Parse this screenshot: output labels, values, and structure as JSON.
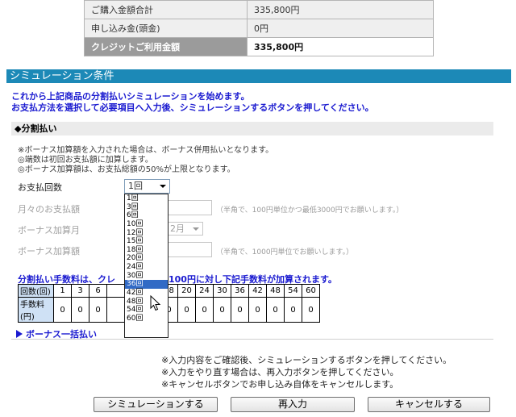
{
  "summary": {
    "rows": [
      {
        "label": "ご購入金額合計",
        "value": "335,800円"
      },
      {
        "label": "申し込み金(頭金)",
        "value": "0円"
      },
      {
        "label": "クレジットご利用金額",
        "value": "335,800円"
      }
    ]
  },
  "section": {
    "title": "シミュレーション条件",
    "intro1": "これから上記商品の分割払いシミュレーションを始めます。",
    "intro2": "お支払方法を選択して必要項目へ入力後、シミュレーションするボタンを押してください。"
  },
  "installment": {
    "heading": "◆分割払い",
    "notes": [
      "※ボーナス加算額を入力された場合は、ボーナス併用払いとなります。",
      "◎端数は初回お支払額に加算します。",
      "◎ボーナス加算額は、お支払総額の50%が上限となります。"
    ],
    "count_label": "お支払回数",
    "count_value": "1回",
    "monthly_label": "月々のお支払額",
    "monthly_hint": "（半角で、100円単位かつ最低3000円でお願いします。）",
    "bonus_month_label": "ボーナス加算月",
    "bonus_month_value": "2月",
    "bonus_amount_label": "ボーナス加算額",
    "bonus_amount_hint": "（半角で、1000円単位でお願いします。）"
  },
  "dropdown": {
    "options": [
      "1回",
      "3回",
      "6回",
      "10回",
      "12回",
      "15回",
      "18回",
      "20回",
      "24回",
      "30回",
      "36回",
      "42回",
      "48回",
      "54回",
      "60回"
    ],
    "highlighted": "36回"
  },
  "fee": {
    "heading": "分割払い手数料は、クレ　　　　金額100円に対し下記手数料が加算されます。",
    "row1_header": "回数(回)",
    "row2_header": "手数料(円)",
    "counts": [
      "1",
      "3",
      "6",
      "",
      "",
      "15",
      "18",
      "20",
      "24",
      "30",
      "36",
      "42",
      "48",
      "54",
      "60"
    ],
    "fees": [
      "0",
      "0",
      "0",
      "",
      "",
      "0",
      "0",
      "0",
      "0",
      "0",
      "0",
      "0",
      "0",
      "0",
      "0"
    ]
  },
  "bonus_lump": {
    "label": "ボーナス一括払い"
  },
  "instructions": [
    "※入力内容をご確認後、シミュレーションするボタンを押してください。",
    "※入力をやり直す場合は、再入力ボタンを押してください。",
    "※キャンセルボタンでお申し込み自体をキャンセルします。"
  ],
  "buttons": {
    "simulate": "シミュレーションする",
    "reenter": "再入力",
    "cancel": "キャンセルする"
  },
  "colors": {
    "section_bar": "#1c89b7",
    "accent_text": "#1a1ad0",
    "highlight": "#316ac5",
    "fee_header_bg": "#cfe1f5"
  }
}
